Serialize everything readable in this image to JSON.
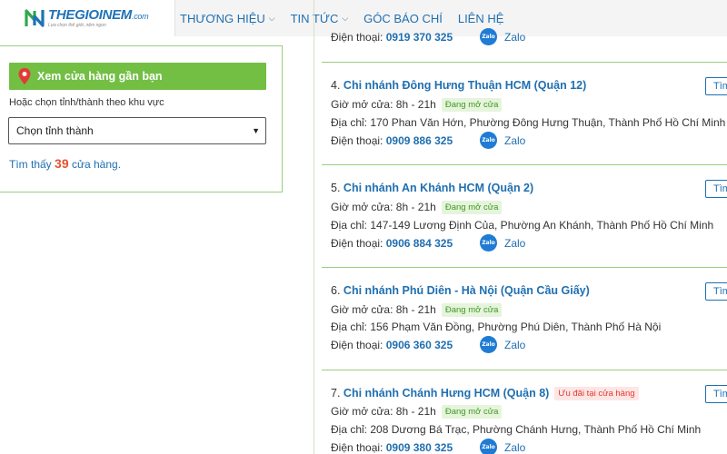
{
  "header": {
    "logo_text": "THEGIOINEM",
    "logo_suffix": ".com",
    "logo_slogan": "Lựa chọn thế giới, nệm ngon",
    "nav": [
      {
        "label": "THƯƠNG HIỆU",
        "has_dropdown": true
      },
      {
        "label": "TIN TỨC",
        "has_dropdown": true
      },
      {
        "label": "GÓC BÁO CHÍ",
        "has_dropdown": false
      },
      {
        "label": "LIÊN HỆ",
        "has_dropdown": false
      }
    ]
  },
  "sidebar": {
    "nearby_button": "Xem cửa hàng gần bạn",
    "region_label": "Hoặc chọn tỉnh/thành theo khu vực",
    "province_select": "Chọn tỉnh thành",
    "found_prefix": "Tìm thấy",
    "found_count": "39",
    "found_suffix": "cửa hàng."
  },
  "colors": {
    "brand_blue": "#1f6fb0",
    "green_accent": "#72bf44",
    "count_orange": "#e5532e",
    "promo_red": "#e53935"
  },
  "labels": {
    "hours_label": "Giờ mở cửa:",
    "address_label": "Địa chỉ:",
    "phone_label": "Điện thoại:",
    "zalo": "Zalo",
    "open_badge": "Đang mở cửa",
    "directions_button": "Tìm"
  },
  "stores": [
    {
      "number": "",
      "name": "",
      "hours": "",
      "address": "",
      "phone": "0919 370 325",
      "partial": true
    },
    {
      "number": "4.",
      "name": "Chi nhánh Đông Hưng Thuận HCM (Quận 12)",
      "hours": "8h - 21h",
      "address": "170 Phan Văn Hớn, Phường Đông Hưng Thuận, Thành Phố Hồ Chí Minh",
      "phone": "0909 886 325"
    },
    {
      "number": "5.",
      "name": "Chi nhánh An Khánh HCM (Quận 2)",
      "hours": "8h - 21h",
      "address": "147-149 Lương Định Của, Phường An Khánh, Thành Phố Hồ Chí Minh",
      "phone": "0906 884 325"
    },
    {
      "number": "6.",
      "name": "Chi nhánh Phú Diên - Hà Nội (Quận Cầu Giấy)",
      "hours": "8h - 21h",
      "address": "156 Phạm Văn Đồng, Phường Phú Diên, Thành Phố Hà Nội",
      "phone": "0906 360 325"
    },
    {
      "number": "7.",
      "name": "Chi nhánh Chánh Hưng HCM (Quận 8)",
      "promo_badge": "Ưu đãi tại cửa hàng",
      "hours": "8h - 21h",
      "address": "208 Dương Bá Trạc, Phường Chánh Hưng, Thành Phố Hồ Chí Minh",
      "phone": "0909 380 325"
    }
  ]
}
